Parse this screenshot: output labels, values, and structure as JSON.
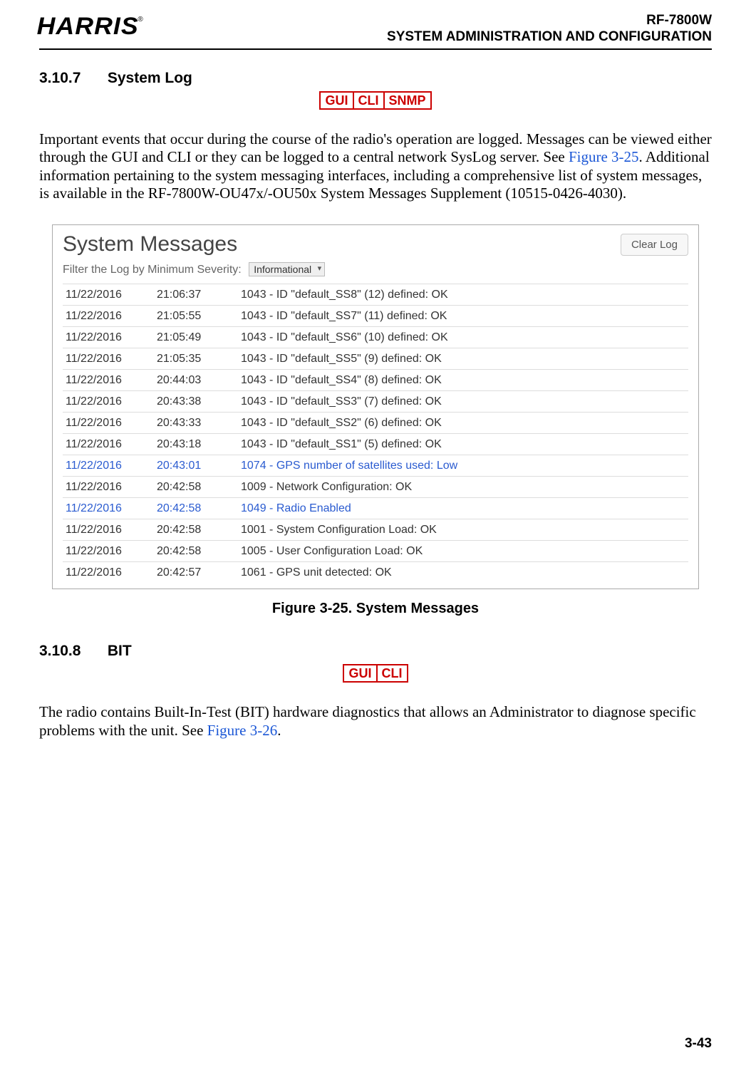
{
  "header": {
    "logo": "HARRIS",
    "registered": "®",
    "model": "RF-7800W",
    "title": "SYSTEM ADMINISTRATION AND CONFIGURATION"
  },
  "section1": {
    "number": "3.10.7",
    "title": "System Log",
    "tags": [
      "GUI",
      "CLI",
      "SNMP"
    ],
    "para_pre": "Important events that occur during the course of the radio's operation are logged. Messages can be viewed either through the GUI and CLI or they can be logged to a central network SysLog server. See ",
    "link": "Figure 3-25",
    "para_post": ". Additional information pertaining to the system messaging interfaces, including a comprehensive list of system messages, is available in the RF-7800W-OU47x/-OU50x System Messages Supplement (10515-0426-4030)."
  },
  "figure": {
    "title": "System Messages",
    "clear_button": "Clear Log",
    "filter_label": "Filter the Log by Minimum Severity:",
    "filter_value": "Informational",
    "caption": "Figure 3-25.  System Messages",
    "rows": [
      {
        "date": "11/22/2016",
        "time": "21:06:37",
        "msg": "1043 - ID \"default_SS8\" (12) defined: OK",
        "blue": false
      },
      {
        "date": "11/22/2016",
        "time": "21:05:55",
        "msg": "1043 - ID \"default_SS7\" (11) defined: OK",
        "blue": false
      },
      {
        "date": "11/22/2016",
        "time": "21:05:49",
        "msg": "1043 - ID \"default_SS6\" (10) defined: OK",
        "blue": false
      },
      {
        "date": "11/22/2016",
        "time": "21:05:35",
        "msg": "1043 - ID \"default_SS5\" (9) defined: OK",
        "blue": false
      },
      {
        "date": "11/22/2016",
        "time": "20:44:03",
        "msg": "1043 - ID \"default_SS4\" (8) defined: OK",
        "blue": false
      },
      {
        "date": "11/22/2016",
        "time": "20:43:38",
        "msg": "1043 - ID \"default_SS3\" (7) defined: OK",
        "blue": false
      },
      {
        "date": "11/22/2016",
        "time": "20:43:33",
        "msg": "1043 - ID \"default_SS2\" (6) defined: OK",
        "blue": false
      },
      {
        "date": "11/22/2016",
        "time": "20:43:18",
        "msg": "1043 - ID \"default_SS1\" (5) defined: OK",
        "blue": false
      },
      {
        "date": "11/22/2016",
        "time": "20:43:01",
        "msg": "1074 - GPS number of satellites used: Low",
        "blue": true
      },
      {
        "date": "11/22/2016",
        "time": "20:42:58",
        "msg": "1009 - Network Configuration: OK",
        "blue": false
      },
      {
        "date": "11/22/2016",
        "time": "20:42:58",
        "msg": "1049 - Radio Enabled",
        "blue": true
      },
      {
        "date": "11/22/2016",
        "time": "20:42:58",
        "msg": "1001 - System Configuration Load: OK",
        "blue": false
      },
      {
        "date": "11/22/2016",
        "time": "20:42:58",
        "msg": "1005 - User Configuration Load: OK",
        "blue": false
      },
      {
        "date": "11/22/2016",
        "time": "20:42:57",
        "msg": "1061 - GPS unit detected: OK",
        "blue": false
      }
    ]
  },
  "section2": {
    "number": "3.10.8",
    "title": "BIT",
    "tags": [
      "GUI",
      "CLI"
    ],
    "para_pre": "The radio contains Built-In-Test (BIT) hardware diagnostics that allows an Administrator to diagnose specific problems with the unit. See ",
    "link": "Figure 3-26",
    "para_post": "."
  },
  "page_number": "3-43"
}
